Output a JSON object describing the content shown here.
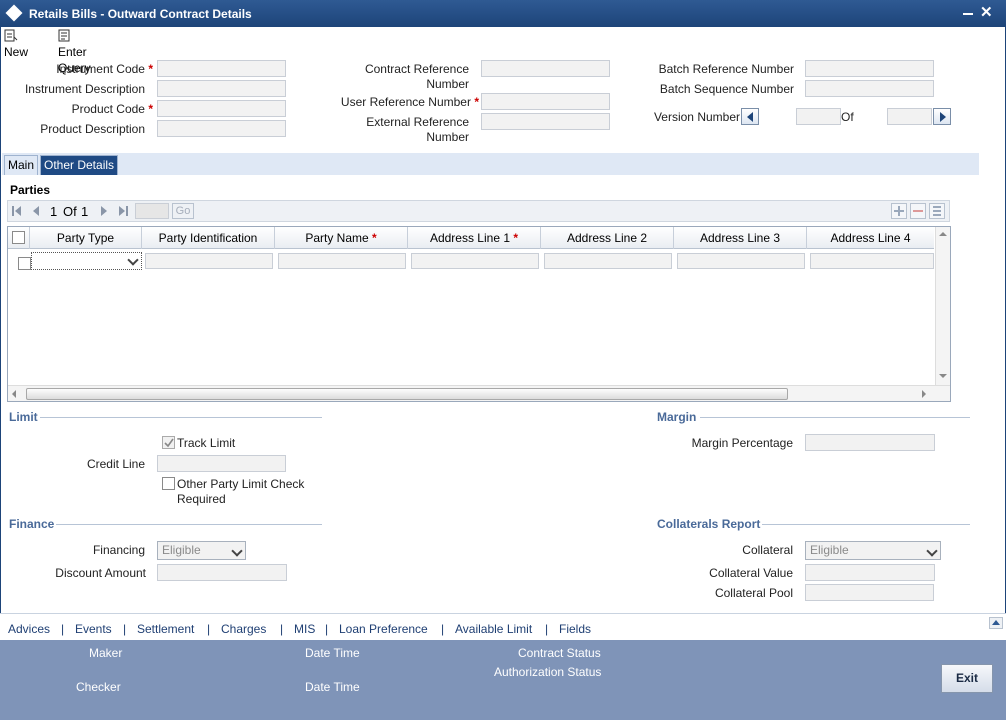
{
  "window": {
    "title": "Retails Bills - Outward Contract Details"
  },
  "toolbar": {
    "new_label": "New",
    "enter_query_label": "Enter Query"
  },
  "header": {
    "instrument_code": "Instrument Code",
    "instrument_description": "Instrument Description",
    "product_code": "Product Code",
    "product_description": "Product Description",
    "contract_ref_1": "Contract Reference",
    "contract_ref_2": "Number",
    "user_ref": "User Reference Number",
    "external_ref_1": "External Reference",
    "external_ref_2": "Number",
    "batch_ref": "Batch Reference Number",
    "batch_seq": "Batch Sequence Number",
    "version_number": "Version Number",
    "of": "Of",
    "required_mark": "*"
  },
  "tabs": [
    {
      "label": "Main"
    },
    {
      "label": "Other Details"
    }
  ],
  "parties": {
    "title": "Parties",
    "pager": {
      "page": "1",
      "of_label": "Of",
      "total": "1",
      "go_label": "Go"
    },
    "columns": [
      "Party Type",
      "Party Identification",
      "Party Name",
      "Address Line 1",
      "Address Line 2",
      "Address Line 3",
      "Address Line 4"
    ]
  },
  "limit": {
    "title": "Limit",
    "track_limit": "Track Limit",
    "track_limit_checked": true,
    "credit_line": "Credit Line",
    "other_party_1": "Other Party Limit Check",
    "other_party_2": "Required",
    "other_party_checked": false
  },
  "margin": {
    "title": "Margin",
    "margin_percentage": "Margin Percentage"
  },
  "finance": {
    "title": "Finance",
    "financing": "Financing",
    "financing_value": "Eligible",
    "discount_amount": "Discount Amount"
  },
  "collaterals": {
    "title": "Collaterals Report",
    "collateral": "Collateral",
    "collateral_value_select": "Eligible",
    "collateral_value": "Collateral Value",
    "collateral_pool": "Collateral Pool"
  },
  "links": [
    "Advices",
    "Events",
    "Settlement",
    "Charges",
    "MIS",
    "Loan Preference",
    "Available Limit",
    "Fields"
  ],
  "link_separator": "|",
  "footer": {
    "maker": "Maker",
    "checker": "Checker",
    "date_time_1": "Date Time",
    "date_time_2": "Date Time",
    "contract_status": "Contract Status",
    "authorization_status": "Authorization Status",
    "exit_label": "Exit"
  }
}
